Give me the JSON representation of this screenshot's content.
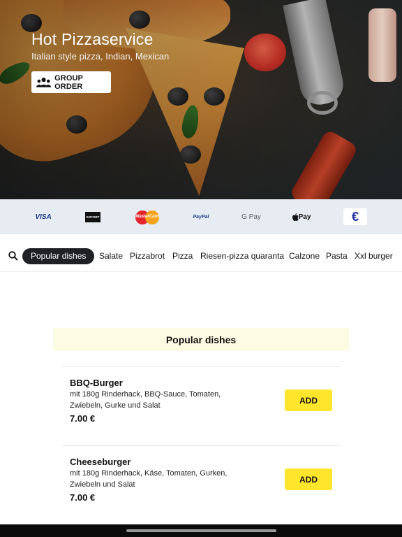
{
  "hero": {
    "title": "Hot Pizzaservice",
    "subtitle": "Italian style pizza, Indian, Mexican",
    "group_order_label": "GROUP ORDER"
  },
  "payments": {
    "visa": "VISA",
    "sofort": "SOFORT",
    "mastercard": "MasterCard",
    "paypal": "PayPal",
    "gpay": "G Pay",
    "applepay": "Pay",
    "euro": "€"
  },
  "categories": {
    "active": "Popular dishes",
    "items": [
      "Salate",
      "Pizzabrot",
      "Pizza",
      "Riesen-pizza quaranta",
      "Calzone",
      "Pasta",
      "Xxl burger"
    ]
  },
  "section": {
    "title": "Popular dishes",
    "dishes": [
      {
        "name": "BBQ-Burger",
        "description": "mit 180g Rinderhack, BBQ-Sauce, Tomaten, Zwiebeln, Gurke und Salat",
        "price": "7.00 €",
        "add_label": "ADD"
      },
      {
        "name": "Cheeseburger",
        "description": "mit 180g Rinderhack, Käse, Tomaten, Gurken, Zwiebeln und Salat",
        "price": "7.00 €",
        "add_label": "ADD"
      }
    ]
  },
  "colors": {
    "accent": "#ffe52c",
    "section_bg": "#fefbe3",
    "payment_bg": "#e7ebf2",
    "active_chip": "#1f2024"
  }
}
